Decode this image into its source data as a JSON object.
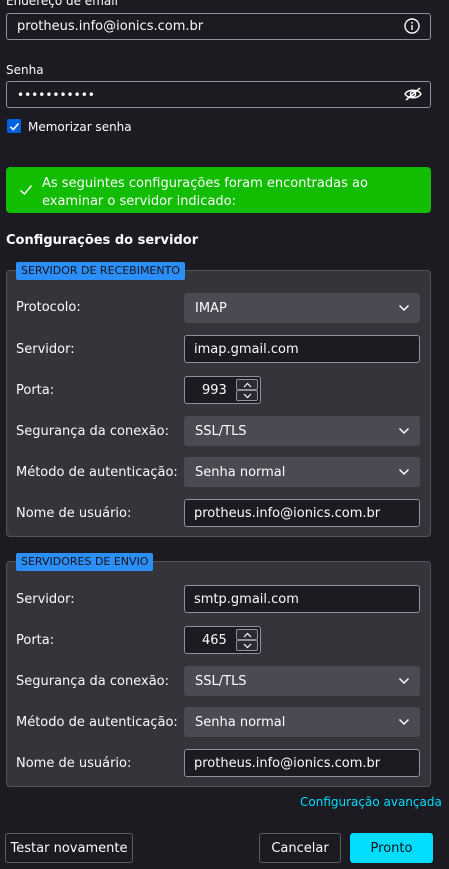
{
  "account": {
    "email_label": "Endereço de email",
    "email_value": "protheus.info@ionics.com.br",
    "password_label": "Senha",
    "password_mask": "•••••••••••",
    "remember_label": "Memorizar senha",
    "remember_checked": true
  },
  "banner": {
    "text": "As seguintes configurações foram encontradas ao examinar o servidor indicado:",
    "color": "#12bc00"
  },
  "server_config": {
    "title": "Configurações do servidor",
    "incoming": {
      "legend": "SERVIDOR DE RECEBIMENTO",
      "protocol_label": "Protocolo:",
      "protocol_value": "IMAP",
      "server_label": "Servidor:",
      "server_value": "imap.gmail.com",
      "port_label": "Porta:",
      "port_value": "993",
      "security_label": "Segurança da conexão:",
      "security_value": "SSL/TLS",
      "auth_label": "Método de autenticação:",
      "auth_value": "Senha normal",
      "username_label": "Nome de usuário:",
      "username_value": "protheus.info@ionics.com.br"
    },
    "outgoing": {
      "legend": "SERVIDORES DE ENVIO",
      "server_label": "Servidor:",
      "server_value": "smtp.gmail.com",
      "port_label": "Porta:",
      "port_value": "465",
      "security_label": "Segurança da conexão:",
      "security_value": "SSL/TLS",
      "auth_label": "Método de autenticação:",
      "auth_value": "Senha normal",
      "username_label": "Nome de usuário:",
      "username_value": "protheus.info@ionics.com.br"
    },
    "advanced_link": "Configuração avançada"
  },
  "buttons": {
    "retest": "Testar novamente",
    "cancel": "Cancelar",
    "done": "Pronto"
  },
  "colors": {
    "accent": "#00ddff",
    "legend_bg": "#2c8ef8",
    "checkbox": "#0060df"
  }
}
